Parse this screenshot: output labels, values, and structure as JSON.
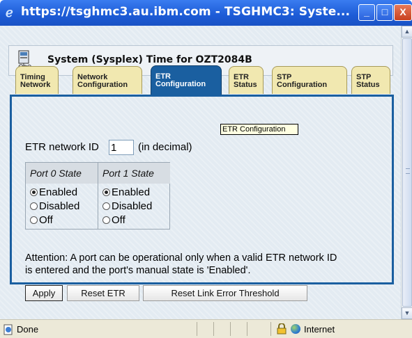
{
  "window": {
    "title": "https://tsghmc3.au.ibm.com - TSGHMC3: Syste...",
    "controls": {
      "minimize": "_",
      "maximize": "□",
      "close": "X"
    }
  },
  "header": {
    "title": "System (Sysplex) Time for OZT2084B",
    "icon": "system-time-icon"
  },
  "tabs": [
    {
      "line1": "Timing",
      "line2": "Network"
    },
    {
      "line1": "Network",
      "line2": "Configuration"
    },
    {
      "line1": "ETR",
      "line2": "Configuration"
    },
    {
      "line1": "ETR",
      "line2": "Status"
    },
    {
      "line1": "STP",
      "line2": "Configuration"
    },
    {
      "line1": "STP",
      "line2": "Status"
    }
  ],
  "active_tab_index": 2,
  "tooltip": "ETR Configuration",
  "etr": {
    "network_id_label": "ETR network ID",
    "network_id_value": "1",
    "network_id_hint": "(in decimal)"
  },
  "ports": {
    "port0": {
      "heading": "Port 0 State",
      "options": [
        "Enabled",
        "Disabled",
        "Off"
      ],
      "selected": "Enabled"
    },
    "port1": {
      "heading": "Port 1 State",
      "options": [
        "Enabled",
        "Disabled",
        "Off"
      ],
      "selected": "Enabled"
    }
  },
  "attention": {
    "line1": "Attention: A port can be operational only when a valid ETR network ID",
    "line2": "is entered and the port's manual state is 'Enabled'."
  },
  "buttons": {
    "apply": "Apply",
    "reset_etr": "Reset ETR",
    "reset_link": "Reset Link Error Threshold"
  },
  "status_bar": {
    "status": "Done",
    "zone": "Internet"
  },
  "colors": {
    "tab_active": "#1a5fa0",
    "tab_inactive": "#f1e8b0",
    "title_bar": "#2a62dc"
  }
}
